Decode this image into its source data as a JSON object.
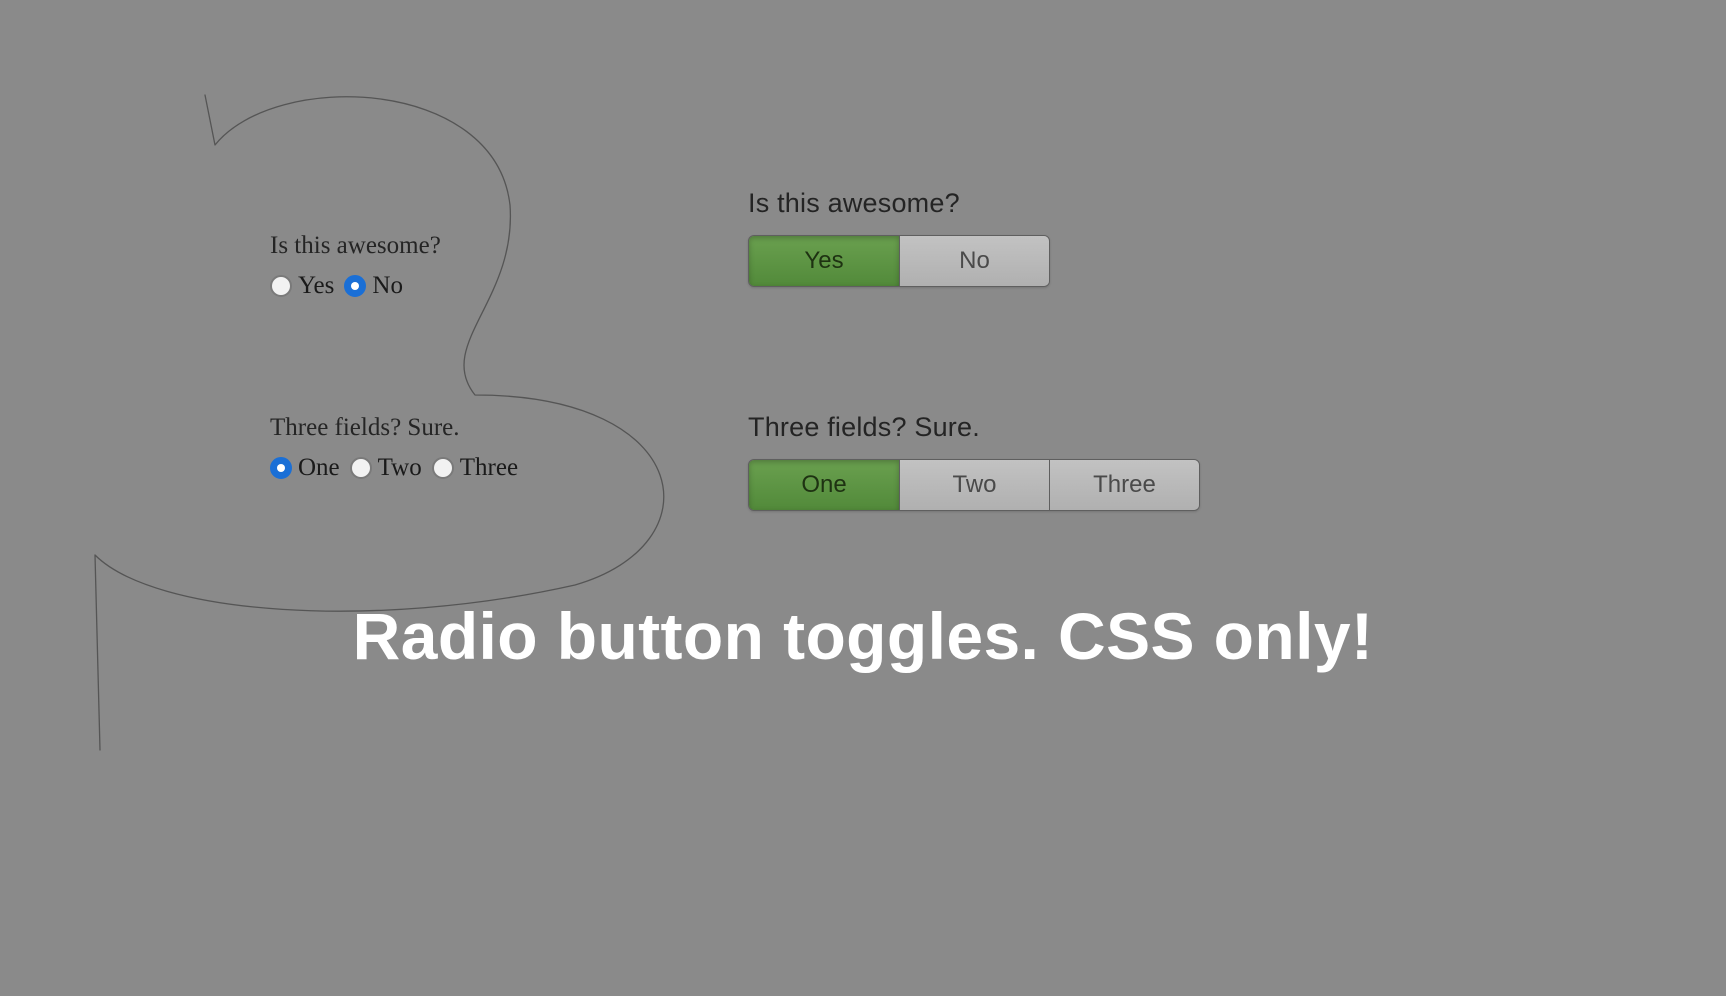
{
  "colors": {
    "background": "#8a8a8a",
    "accent_blue": "#1a6fd6",
    "active_green": "#5b9443",
    "inactive_gray": "#b6b6b6",
    "title_white": "#ffffff"
  },
  "left": {
    "group1": {
      "label": "Is this awesome?",
      "options": [
        {
          "label": "Yes",
          "checked": false
        },
        {
          "label": "No",
          "checked": true
        }
      ]
    },
    "group2": {
      "label": "Three fields? Sure.",
      "options": [
        {
          "label": "One",
          "checked": true
        },
        {
          "label": "Two",
          "checked": false
        },
        {
          "label": "Three",
          "checked": false
        }
      ]
    }
  },
  "right": {
    "group1": {
      "label": "Is this awesome?",
      "options": [
        {
          "label": "Yes",
          "active": true
        },
        {
          "label": "No",
          "active": false
        }
      ]
    },
    "group2": {
      "label": "Three fields? Sure.",
      "options": [
        {
          "label": "One",
          "active": true
        },
        {
          "label": "Two",
          "active": false
        },
        {
          "label": "Three",
          "active": false
        }
      ]
    }
  },
  "title": "Radio button toggles. CSS only!"
}
